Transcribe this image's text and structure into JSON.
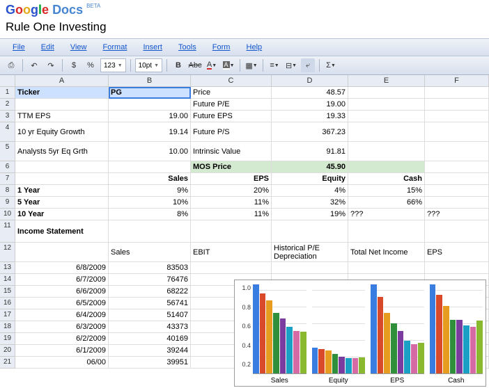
{
  "app": {
    "name": "Google",
    "product": "Docs",
    "beta": "BETA",
    "doc_title": "Rule One Investing"
  },
  "menu": [
    "File",
    "Edit",
    "View",
    "Format",
    "Insert",
    "Tools",
    "Form",
    "Help"
  ],
  "toolbar": {
    "font_size": "10pt",
    "num_fmt": "123"
  },
  "columns": [
    "A",
    "B",
    "C",
    "D",
    "E",
    "F"
  ],
  "sheet": {
    "r1": {
      "a": "Ticker",
      "b": "PG",
      "c": "Price",
      "d": "48.57"
    },
    "r2": {
      "c": "Future P/E",
      "d": "19.00"
    },
    "r3": {
      "a": "TTM EPS",
      "b": "19.00",
      "c": "Future EPS",
      "d": "19.33"
    },
    "r4": {
      "a": "10 yr Equity Growth",
      "b": "19.14",
      "c": "Future P/S",
      "d": "367.23"
    },
    "r5": {
      "a": "Analysts 5yr Eq Grth",
      "b": "10.00",
      "c": "Intrinsic Value",
      "d": "91.81"
    },
    "r6": {
      "c": "MOS Price",
      "d": "45.90"
    },
    "r7": {
      "b": "Sales",
      "c": "EPS",
      "d": "Equity",
      "e": "Cash"
    },
    "r8": {
      "a": "1 Year",
      "b": "9%",
      "c": "20%",
      "d": "4%",
      "e": "15%"
    },
    "r9": {
      "a": "5 Year",
      "b": "10%",
      "c": "11%",
      "d": "32%",
      "e": "66%"
    },
    "r10": {
      "a": "10 Year",
      "b": "8%",
      "c": "11%",
      "d": "19%",
      "e": "???",
      "f": "???"
    },
    "r11": {
      "a": "Income Statement"
    },
    "r12": {
      "b": "Sales",
      "c": "EBIT",
      "d": "Historical P/E Depreciation",
      "e": "Total Net Income",
      "f": "EPS"
    },
    "r13": {
      "a": "6/8/2009",
      "b": "83503"
    },
    "r14": {
      "a": "6/7/2009",
      "b": "76476"
    },
    "r15": {
      "a": "6/6/2009",
      "b": "68222"
    },
    "r16": {
      "a": "6/5/2009",
      "b": "56741"
    },
    "r17": {
      "a": "6/4/2009",
      "b": "51407"
    },
    "r18": {
      "a": "6/3/2009",
      "b": "43373"
    },
    "r19": {
      "a": "6/2/2009",
      "b": "40169"
    },
    "r20": {
      "a": "6/1/2009",
      "b": "39244"
    },
    "r21": {
      "a": "06/00",
      "b": "39951"
    }
  },
  "chart_data": {
    "type": "bar",
    "ylim": [
      0,
      1.0
    ],
    "yticks": [
      "0.2",
      "0.4",
      "0.6",
      "0.8",
      "1.0"
    ],
    "categories": [
      "Sales",
      "Equity",
      "EPS",
      "Cash"
    ],
    "colors": [
      "#3a7de0",
      "#d94a2b",
      "#e69c1e",
      "#2f8f3a",
      "#7a3c9e",
      "#19a0c4",
      "#d66aa5",
      "#8ab82e"
    ],
    "series": [
      {
        "name": "Sales",
        "values": [
          1.0,
          0.9,
          0.82,
          0.68,
          0.62,
          0.52,
          0.48,
          0.47
        ]
      },
      {
        "name": "Equity",
        "values": [
          0.29,
          0.27,
          0.26,
          0.22,
          0.19,
          0.17,
          0.17,
          0.18
        ]
      },
      {
        "name": "EPS",
        "values": [
          1.0,
          0.86,
          0.68,
          0.56,
          0.48,
          0.37,
          0.33,
          0.34
        ]
      },
      {
        "name": "Cash",
        "values": [
          1.0,
          0.88,
          0.76,
          0.6,
          0.6,
          0.54,
          0.52,
          0.59
        ]
      }
    ]
  }
}
